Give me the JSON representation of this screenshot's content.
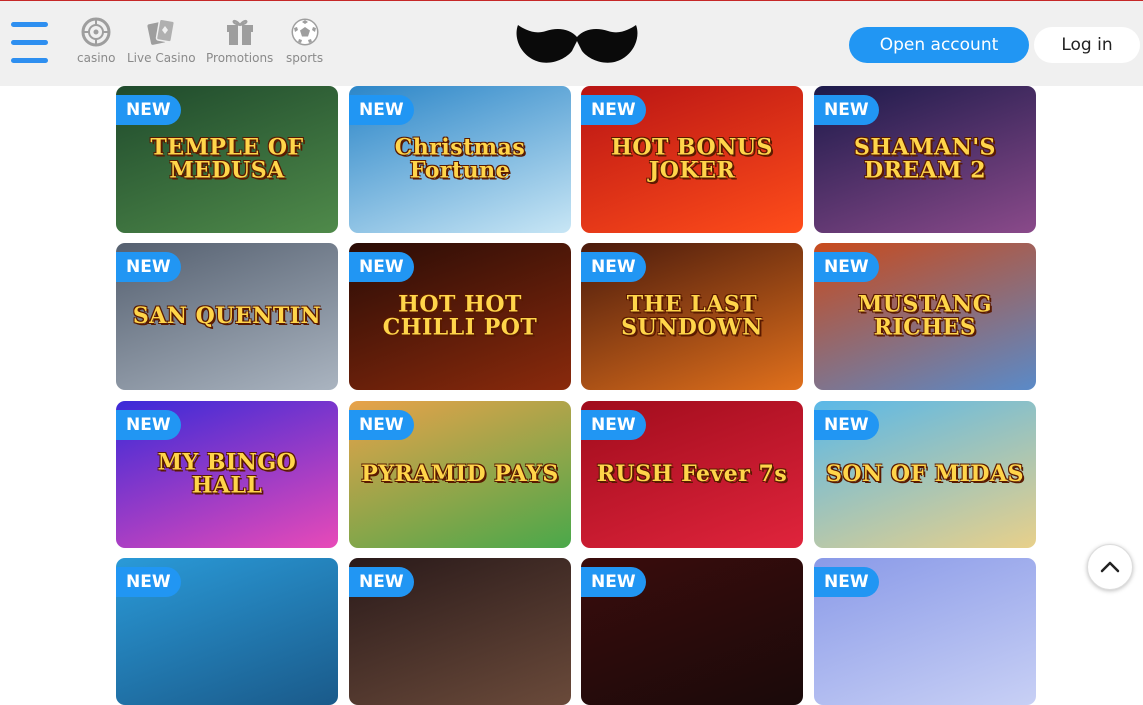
{
  "header": {
    "nav": [
      {
        "label": "casino",
        "icon": "roulette-icon"
      },
      {
        "label": "Live Casino",
        "icon": "cards-icon"
      },
      {
        "label": "Promotions",
        "icon": "gift-icon"
      },
      {
        "label": "sports",
        "icon": "soccer-ball-icon"
      }
    ],
    "logo": "mustache-logo",
    "open_account_label": "Open account",
    "login_label": "Log in"
  },
  "badge_label": "NEW",
  "games": [
    {
      "title": "TEMPLE OF MEDUSA",
      "bg": [
        "#1f4a2c",
        "#4f8a4a"
      ]
    },
    {
      "title": "Christmas Fortune",
      "bg": [
        "#2c86c8",
        "#c8e6f5"
      ]
    },
    {
      "title": "HOT BONUS JOKER",
      "bg": [
        "#b81414",
        "#ff4d1a"
      ]
    },
    {
      "title": "SHAMAN'S DREAM 2",
      "bg": [
        "#1c1a4a",
        "#8a4a8a"
      ]
    },
    {
      "title": "SAN QUENTIN",
      "bg": [
        "#556070",
        "#aab4c0"
      ]
    },
    {
      "title": "HOT HOT CHILLI POT",
      "bg": [
        "#2a0c06",
        "#8a2a0c"
      ]
    },
    {
      "title": "THE LAST SUNDOWN",
      "bg": [
        "#4a1a0c",
        "#e0701c"
      ]
    },
    {
      "title": "MUSTANG RICHES",
      "bg": [
        "#c84a1c",
        "#5a8ac8"
      ]
    },
    {
      "title": "MY BINGO HALL",
      "bg": [
        "#3a2ad8",
        "#e84ab8"
      ]
    },
    {
      "title": "PYRAMID PAYS",
      "bg": [
        "#e8a24a",
        "#4aa84a"
      ]
    },
    {
      "title": "RUSH Fever 7s",
      "bg": [
        "#a00c1c",
        "#e0243c"
      ]
    },
    {
      "title": "SON OF MIDAS",
      "bg": [
        "#5ab8e8",
        "#e8d08a"
      ]
    },
    {
      "title": "",
      "bg": [
        "#2a9ad8",
        "#1a5a8a"
      ]
    },
    {
      "title": "",
      "bg": [
        "#2a1a1a",
        "#6a4a3a"
      ]
    },
    {
      "title": "",
      "bg": [
        "#3a0c0c",
        "#1a0a0a"
      ]
    },
    {
      "title": "",
      "bg": [
        "#8a9ae8",
        "#c8d0f5"
      ]
    }
  ],
  "colors": {
    "accent": "#2196f3",
    "header_bg": "#f0f0f0",
    "top_line": "#c62828"
  }
}
